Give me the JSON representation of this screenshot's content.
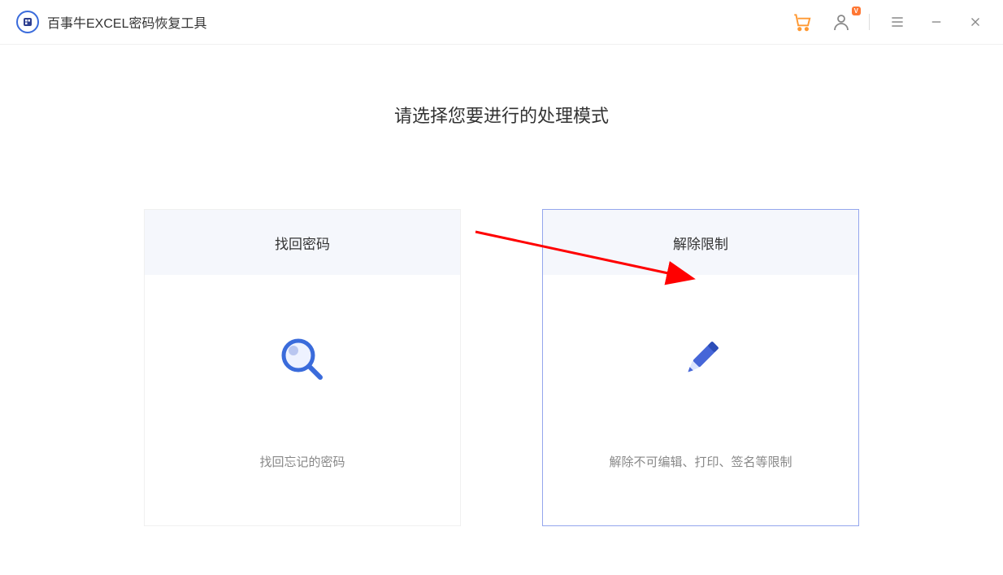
{
  "app": {
    "title": "百事牛EXCEL密码恢复工具"
  },
  "header": {
    "vip_badge": "V"
  },
  "main": {
    "prompt_title": "请选择您要进行的处理模式",
    "cards": [
      {
        "title": "找回密码",
        "description": "找回忘记的密码"
      },
      {
        "title": "解除限制",
        "description": "解除不可编辑、打印、签名等限制"
      }
    ]
  },
  "colors": {
    "accent": "#3a6bdb",
    "cart": "#ff9933",
    "icon_gray": "#888888",
    "border_selected": "#94a6ed"
  }
}
